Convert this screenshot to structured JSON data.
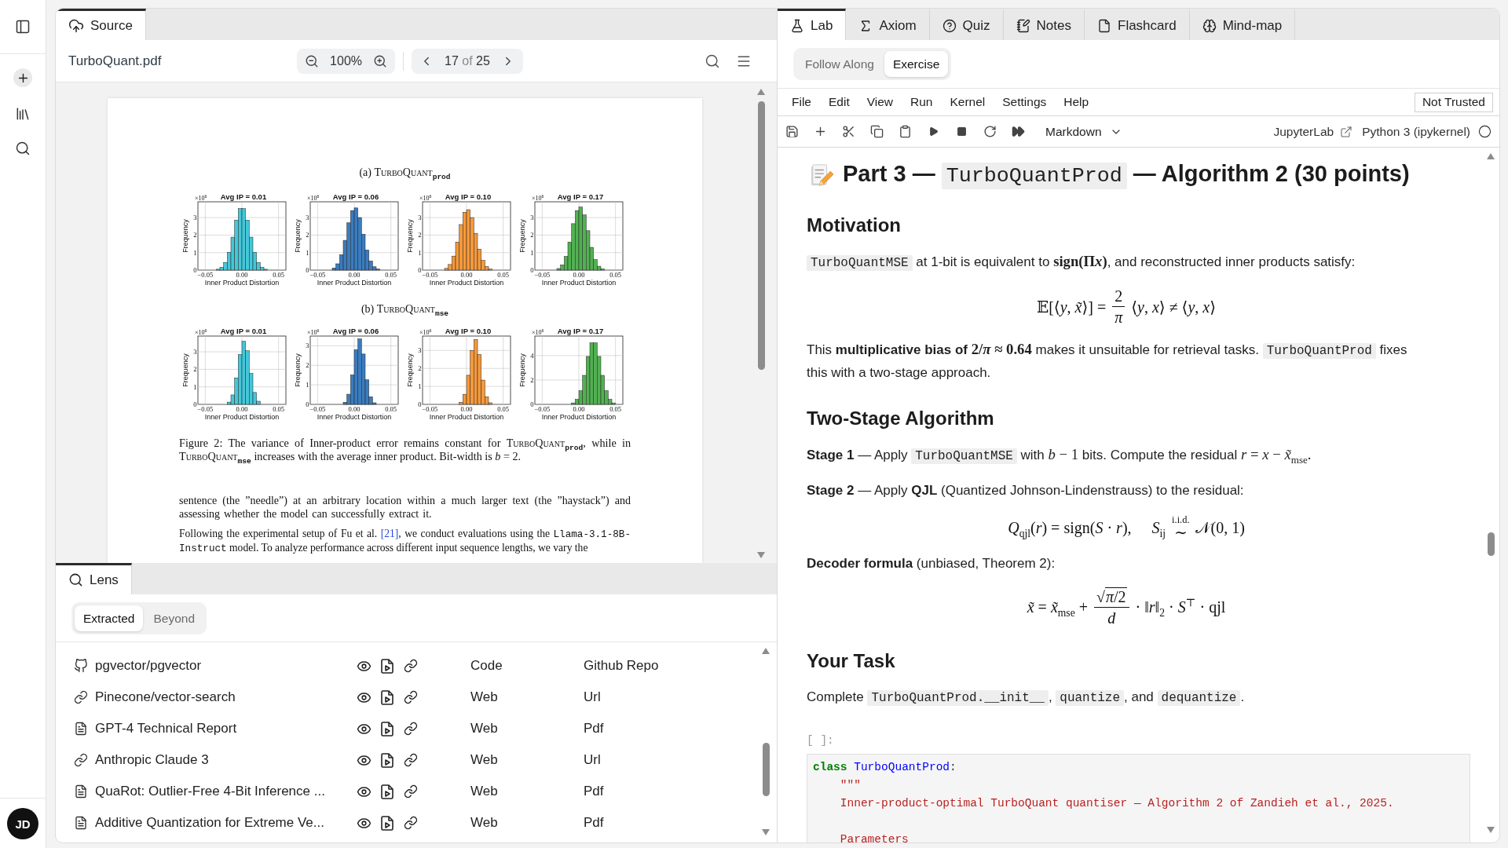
{
  "sidebar": {
    "avatar": "JD"
  },
  "source_panel": {
    "tab": {
      "label": "Source",
      "selected": true
    },
    "file_name": "TurboQuant.pdf",
    "zoom": "100%",
    "page": {
      "current": "17",
      "separator": "of",
      "total": "25"
    },
    "document": {
      "figures": [
        {
          "caption": [
            {
              "kind": "text",
              "text": "(a) "
            },
            {
              "kind": "smallcaps",
              "text": "TurboQuant"
            },
            {
              "kind": "text",
              "text": "$_{prod}$"
            }
          ],
          "charts": [
            {
              "scale_label": "×10$^{6}$",
              "chart_data": {
                "type": "bar",
                "title": "Avg IP = 0.01",
                "xlabel": "Inner Product Distortion",
                "ylabel": "Frequency",
                "x": [
                  -0.0325,
                  -0.0275,
                  -0.0225,
                  -0.0175,
                  -0.0125,
                  -0.0075,
                  -0.0025,
                  0.0025,
                  0.0075,
                  0.0125,
                  0.0175,
                  0.0225,
                  0.0275,
                  0.0325
                ],
                "series": [
                  {
                    "color": "#44c7d9",
                    "values": [
                      0.05,
                      0.16,
                      0.44,
                      1.02,
                      1.88,
                      2.85,
                      3.51,
                      3.51,
                      2.85,
                      1.88,
                      1.02,
                      0.44,
                      0.16,
                      0.05
                    ]
                  }
                ],
                "xlim": [
                  -0.06,
                  0.06
                ],
                "ylim": [
                  0,
                  3.9
                ],
                "xticks": [
                  {
                    "value": -0.05,
                    "label": "−0.05"
                  },
                  {
                    "value": 0,
                    "label": "0.00"
                  },
                  {
                    "value": 0.05,
                    "label": "0.05"
                  }
                ],
                "yticks": [
                  {
                    "value": 0,
                    "label": "0"
                  },
                  {
                    "value": 1,
                    "label": "1"
                  },
                  {
                    "value": 2,
                    "label": "2"
                  },
                  {
                    "value": 3,
                    "label": "3"
                  }
                ],
                "grid": true
              }
            },
            {
              "scale_label": "×10$^{6}$",
              "chart_data": {
                "type": "bar",
                "title": "Avg IP = 0.06",
                "xlabel": "Inner Product Distortion",
                "ylabel": "Frequency",
                "x": [
                  -0.0275,
                  -0.0225,
                  -0.0175,
                  -0.0125,
                  -0.0075,
                  -0.0025,
                  0.0025,
                  0.0075,
                  0.0125,
                  0.0175,
                  0.0225,
                  0.0275,
                  0.0325
                ],
                "series": [
                  {
                    "color": "#3b7cbf",
                    "values": [
                      0.12,
                      0.36,
                      0.88,
                      1.7,
                      2.7,
                      3.4,
                      3.55,
                      3.0,
                      2.05,
                      1.15,
                      0.52,
                      0.19,
                      0.06
                    ]
                  }
                ],
                "xlim": [
                  -0.06,
                  0.06
                ],
                "ylim": [
                  0,
                  3.9
                ],
                "xticks": [
                  {
                    "value": -0.05,
                    "label": "−0.05"
                  },
                  {
                    "value": 0,
                    "label": "0.00"
                  },
                  {
                    "value": 0.05,
                    "label": "0.05"
                  }
                ],
                "yticks": [
                  {
                    "value": 0,
                    "label": "0"
                  },
                  {
                    "value": 1,
                    "label": "1"
                  },
                  {
                    "value": 2,
                    "label": "2"
                  },
                  {
                    "value": 3,
                    "label": "3"
                  }
                ],
                "grid": true
              }
            },
            {
              "scale_label": "×10$^{6}$",
              "chart_data": {
                "type": "bar",
                "title": "Avg IP = 0.10",
                "xlabel": "Inner Product Distortion",
                "ylabel": "Frequency",
                "x": [
                  -0.0275,
                  -0.0225,
                  -0.0175,
                  -0.0125,
                  -0.0075,
                  -0.0025,
                  0.0025,
                  0.0075,
                  0.0125,
                  0.0175,
                  0.0225,
                  0.0275,
                  0.0325
                ],
                "series": [
                  {
                    "color": "#f5993b",
                    "values": [
                      0.1,
                      0.32,
                      0.8,
                      1.6,
                      2.6,
                      3.3,
                      3.45,
                      3.0,
                      2.1,
                      1.2,
                      0.55,
                      0.2,
                      0.06
                    ]
                  }
                ],
                "xlim": [
                  -0.06,
                  0.06
                ],
                "ylim": [
                  0,
                  3.9
                ],
                "xticks": [
                  {
                    "value": -0.05,
                    "label": "−0.05"
                  },
                  {
                    "value": 0,
                    "label": "0.00"
                  },
                  {
                    "value": 0.05,
                    "label": "0.05"
                  }
                ],
                "yticks": [
                  {
                    "value": 0,
                    "label": "0"
                  },
                  {
                    "value": 1,
                    "label": "1"
                  },
                  {
                    "value": 2,
                    "label": "2"
                  },
                  {
                    "value": 3,
                    "label": "3"
                  }
                ],
                "grid": true
              }
            },
            {
              "scale_label": "×10$^{6}$",
              "chart_data": {
                "type": "bar",
                "title": "Avg IP = 0.17",
                "xlabel": "Inner Product Distortion",
                "ylabel": "Frequency",
                "x": [
                  -0.0275,
                  -0.0225,
                  -0.0175,
                  -0.0125,
                  -0.0075,
                  -0.0025,
                  0.0025,
                  0.0075,
                  0.0125,
                  0.0175,
                  0.0225,
                  0.0275,
                  0.0325
                ],
                "series": [
                  {
                    "color": "#52b152",
                    "values": [
                      0.09,
                      0.3,
                      0.78,
                      1.6,
                      2.65,
                      3.4,
                      3.6,
                      3.15,
                      2.25,
                      1.3,
                      0.6,
                      0.22,
                      0.07
                    ]
                  }
                ],
                "xlim": [
                  -0.06,
                  0.06
                ],
                "ylim": [
                  0,
                  3.9
                ],
                "xticks": [
                  {
                    "value": -0.05,
                    "label": "−0.05"
                  },
                  {
                    "value": 0,
                    "label": "0.00"
                  },
                  {
                    "value": 0.05,
                    "label": "0.05"
                  }
                ],
                "yticks": [
                  {
                    "value": 0,
                    "label": "0"
                  },
                  {
                    "value": 1,
                    "label": "1"
                  },
                  {
                    "value": 2,
                    "label": "2"
                  },
                  {
                    "value": 3,
                    "label": "3"
                  }
                ],
                "grid": true
              }
            }
          ]
        },
        {
          "caption": [
            {
              "kind": "text",
              "text": "(b) "
            },
            {
              "kind": "smallcaps",
              "text": "TurboQuant"
            },
            {
              "kind": "text",
              "text": "$_{mse}$"
            }
          ],
          "charts": [
            {
              "scale_label": "×10$^{6}$",
              "chart_data": {
                "type": "bar",
                "title": "Avg IP = 0.01",
                "xlabel": "Inner Product Distortion",
                "ylabel": "Frequency",
                "x": [
                  -0.0175,
                  -0.0125,
                  -0.0075,
                  -0.0025,
                  0.0025,
                  0.0075,
                  0.0125,
                  0.0175,
                  0.0225
                ],
                "series": [
                  {
                    "color": "#44c7d9",
                    "values": [
                      0.13,
                      0.54,
                      1.51,
                      2.84,
                      3.6,
                      3.06,
                      1.76,
                      0.68,
                      0.18
                    ]
                  }
                ],
                "xlim": [
                  -0.06,
                  0.06
                ],
                "ylim": [
                  0,
                  3.9
                ],
                "xticks": [
                  {
                    "value": -0.05,
                    "label": "−0.05"
                  },
                  {
                    "value": 0,
                    "label": "0.00"
                  },
                  {
                    "value": 0.05,
                    "label": "0.05"
                  }
                ],
                "yticks": [
                  {
                    "value": 0,
                    "label": "0"
                  },
                  {
                    "value": 1,
                    "label": "1"
                  },
                  {
                    "value": 2,
                    "label": "2"
                  },
                  {
                    "value": 3,
                    "label": "3"
                  }
                ],
                "grid": true
              }
            },
            {
              "scale_label": "×10$^{6}$",
              "chart_data": {
                "type": "bar",
                "title": "Avg IP = 0.06",
                "xlabel": "Inner Product Distortion",
                "ylabel": "Frequency",
                "x": [
                  -0.0125,
                  -0.0075,
                  -0.0025,
                  0.0025,
                  0.0075,
                  0.0125,
                  0.0175,
                  0.0225,
                  0.0275
                ],
                "series": [
                  {
                    "color": "#3b7cbf",
                    "values": [
                      0.11,
                      0.52,
                      1.51,
                      2.8,
                      3.35,
                      2.58,
                      1.26,
                      0.39,
                      0.08
                    ]
                  }
                ],
                "xlim": [
                  -0.06,
                  0.06
                ],
                "ylim": [
                  0,
                  3.5
                ],
                "xticks": [
                  {
                    "value": -0.05,
                    "label": "−0.05"
                  },
                  {
                    "value": 0,
                    "label": "0.00"
                  },
                  {
                    "value": 0.05,
                    "label": "0.05"
                  }
                ],
                "yticks": [
                  {
                    "value": 0,
                    "label": "0"
                  },
                  {
                    "value": 1,
                    "label": "1"
                  },
                  {
                    "value": 2,
                    "label": "2"
                  },
                  {
                    "value": 3,
                    "label": "3"
                  }
                ],
                "grid": true
              }
            },
            {
              "scale_label": "×10$^{6}$",
              "chart_data": {
                "type": "bar",
                "title": "Avg IP = 0.10",
                "xlabel": "Inner Product Distortion",
                "ylabel": "Frequency",
                "x": [
                  -0.0075,
                  -0.0025,
                  0.0025,
                  0.0075,
                  0.0125,
                  0.0175,
                  0.0225,
                  0.0275,
                  0.0325
                ],
                "series": [
                  {
                    "color": "#f5993b",
                    "values": [
                      0.12,
                      0.56,
                      1.62,
                      3.0,
                      3.6,
                      2.77,
                      1.35,
                      0.42,
                      0.09
                    ]
                  }
                ],
                "xlim": [
                  -0.06,
                  0.06
                ],
                "ylim": [
                  0,
                  3.8
                ],
                "xticks": [
                  {
                    "value": -0.05,
                    "label": "−0.05"
                  },
                  {
                    "value": 0,
                    "label": "0.00"
                  },
                  {
                    "value": 0.05,
                    "label": "0.05"
                  }
                ],
                "yticks": [
                  {
                    "value": 0,
                    "label": "0"
                  },
                  {
                    "value": 1,
                    "label": "1"
                  },
                  {
                    "value": 2,
                    "label": "2"
                  },
                  {
                    "value": 3,
                    "label": "3"
                  }
                ],
                "grid": true
              }
            },
            {
              "scale_label": "×10$^{6}$",
              "chart_data": {
                "type": "bar",
                "title": "Avg IP = 0.17",
                "xlabel": "Inner Product Distortion",
                "ylabel": "Frequency",
                "x": [
                  -0.0075,
                  -0.0025,
                  0.0025,
                  0.0075,
                  0.0125,
                  0.0175,
                  0.0225,
                  0.0275,
                  0.0325,
                  0.0375,
                  0.0425,
                  0.0475
                ],
                "series": [
                  {
                    "color": "#52b152",
                    "values": [
                      0.12,
                      0.41,
                      1.12,
                      2.38,
                      3.93,
                      5.04,
                      5.04,
                      3.93,
                      2.38,
                      1.12,
                      0.41,
                      0.12
                    ]
                  }
                ],
                "xlim": [
                  -0.06,
                  0.06
                ],
                "ylim": [
                  0,
                  5.6
                ],
                "xticks": [
                  {
                    "value": -0.05,
                    "label": "−0.05"
                  },
                  {
                    "value": 0,
                    "label": "0.00"
                  },
                  {
                    "value": 0.05,
                    "label": "0.05"
                  }
                ],
                "yticks": [
                  {
                    "value": 0,
                    "label": "0"
                  },
                  {
                    "value": 2,
                    "label": "2"
                  },
                  {
                    "value": 4,
                    "label": "4"
                  }
                ],
                "grid": true
              }
            }
          ]
        }
      ],
      "figure_caption": [
        {
          "kind": "text",
          "text": "Figure 2: The variance of Inner-product error remains constant for "
        },
        {
          "kind": "smallcaps",
          "text": "TurboQuant"
        },
        {
          "kind": "text",
          "text": "$_{prod}$, while in "
        },
        {
          "kind": "smallcaps",
          "text": "TurboQuant"
        },
        {
          "kind": "text",
          "text": "$_{mse}$ increases with the average inner product. Bit-width is *b* = 2."
        }
      ],
      "paragraphs": [
        [
          {
            "kind": "text",
            "text": "sentence (the ”needle”) at an arbitrary location within a much larger text (the ”haystack”) and assessing whether the model can successfully extract it."
          }
        ],
        [
          {
            "kind": "text",
            "text": "Following the experimental setup of Fu et al. "
          },
          {
            "kind": "link",
            "text": "[21]"
          },
          {
            "kind": "text",
            "text": ", we conduct evaluations using the "
          },
          {
            "kind": "mono",
            "text": "Llama-3.1-8B-Instruct"
          },
          {
            "kind": "text",
            "text": " model. To analyze performance across different input sequence lengths, we vary the"
          }
        ]
      ]
    }
  },
  "lens_panel": {
    "tab": {
      "label": "Lens",
      "selected": true
    },
    "modes": [
      {
        "label": "Extracted",
        "selected": true
      },
      {
        "label": "Beyond",
        "selected": false
      }
    ],
    "items": [
      {
        "kind": "github",
        "title": "pgvector/pgvector",
        "column_2": "Code",
        "column_3": "Github Repo"
      },
      {
        "kind": "link",
        "title": "Pinecone/vector-search",
        "column_2": "Web",
        "column_3": "Url"
      },
      {
        "kind": "file",
        "title": "GPT-4 Technical Report",
        "column_2": "Web",
        "column_3": "Pdf"
      },
      {
        "kind": "link",
        "title": "Anthropic Claude 3",
        "column_2": "Web",
        "column_3": "Url"
      },
      {
        "kind": "file",
        "title": "QuaRot: Outlier-Free 4-Bit Inference ...",
        "column_2": "Web",
        "column_3": "Pdf"
      },
      {
        "kind": "file",
        "title": "Additive Quantization for Extreme Ve...",
        "column_2": "Web",
        "column_3": "Pdf"
      }
    ]
  },
  "lab_panel": {
    "tabs": [
      {
        "kind": "lab",
        "label": "Lab",
        "selected": true
      },
      {
        "kind": "axiom",
        "label": "Axiom",
        "selected": false
      },
      {
        "kind": "quiz",
        "label": "Quiz",
        "selected": false
      },
      {
        "kind": "notes",
        "label": "Notes",
        "selected": false
      },
      {
        "kind": "flashcard",
        "label": "Flashcard",
        "selected": false
      },
      {
        "kind": "mindmap",
        "label": "Mind-map",
        "selected": false
      }
    ],
    "modes": [
      {
        "label": "Follow Along",
        "selected": false
      },
      {
        "label": "Exercise",
        "selected": true
      }
    ],
    "menu": [
      "File",
      "Edit",
      "View",
      "Run",
      "Kernel",
      "Settings",
      "Help"
    ],
    "trust_status": "Not Trusted",
    "cell_type": "Markdown",
    "jupyter_link": "JupyterLab",
    "kernel": "Python 3 (ipykernel)",
    "notebook": [
      {
        "kind": "title",
        "segments": [
          {
            "kind": "text",
            "text": "Part 3 — "
          },
          {
            "kind": "code",
            "text": "TurboQuantProd"
          },
          {
            "kind": "text",
            "text": " — Algorithm 2 (30 points)"
          }
        ]
      },
      {
        "kind": "heading",
        "text": "Motivation"
      },
      {
        "kind": "paragraph",
        "segments": [
          {
            "kind": "code",
            "text": "TurboQuantMSE"
          },
          {
            "kind": "text",
            "text": " at 1-bit is equivalent to "
          },
          {
            "kind": "math_bold",
            "text": "sign(Π"
          },
          {
            "kind": "math_bold",
            "text": "*x*)"
          },
          {
            "kind": "text",
            "text": ", and reconstructed inner products satisfy:"
          }
        ]
      },
      {
        "kind": "fraction_formula",
        "lhs": "𝔼[⟨*y*, *x̃*⟩] =",
        "numerator": "2",
        "denominator": "*π*",
        "rhs": "⟨*y*, *x*⟩ ≠ ⟨*y*, *x*⟩"
      },
      {
        "kind": "paragraph",
        "segments": [
          {
            "kind": "text",
            "text": "This **multiplicative bias of** "
          },
          {
            "kind": "math_bold",
            "text": "2/*π* ≈ 0.64"
          },
          {
            "kind": "text",
            "text": " makes it unsuitable for retrieval tasks. "
          },
          {
            "kind": "code",
            "text": "TurboQuantProd"
          },
          {
            "kind": "text",
            "text": " fixes this with a two-stage approach."
          }
        ]
      },
      {
        "kind": "heading",
        "text": "Two-Stage Algorithm"
      },
      {
        "kind": "paragraph",
        "segments": [
          {
            "kind": "text",
            "text": "**Stage 1** — Apply "
          },
          {
            "kind": "code",
            "text": "TurboQuantMSE"
          },
          {
            "kind": "text",
            "text": " with "
          },
          {
            "kind": "math",
            "text": "*b* − 1"
          },
          {
            "kind": "text",
            "text": " bits. Compute the residual "
          },
          {
            "kind": "math",
            "text": "*r* = *x* − *x̃*$_{mse}$."
          }
        ]
      },
      {
        "kind": "paragraph",
        "segments": [
          {
            "kind": "text",
            "text": "**Stage 2** — Apply **QJL** (Quantized Johnson-Lindenstrauss) to the residual:"
          }
        ]
      },
      {
        "kind": "relation_formula",
        "lhs": "*Q*$_{qjl}$(*r*) = sign(*S* · *r*),",
        "subject": "*S*$_{ij}$",
        "relation": "∼",
        "relation_label": "i.i.d.",
        "rhs": "𝒩(0, 1)"
      },
      {
        "kind": "paragraph",
        "segments": [
          {
            "kind": "text",
            "text": "**Decoder formula** (unbiased, Theorem 2):"
          }
        ]
      },
      {
        "kind": "root_fraction_formula",
        "lhs": "*x̃* = *x̃*$_{mse}$ +",
        "radical": "√",
        "radicand": "*π*/2",
        "denominator": "*d*",
        "rhs": "· ‖*r*‖$_{2}$ · *S*$^{⊤}$ · qjl"
      },
      {
        "kind": "heading",
        "text": "Your Task"
      },
      {
        "kind": "paragraph",
        "segments": [
          {
            "kind": "text",
            "text": "Complete "
          },
          {
            "kind": "code",
            "text": "TurboQuantProd.__init__"
          },
          {
            "kind": "text",
            "text": ", "
          },
          {
            "kind": "code",
            "text": "quantize"
          },
          {
            "kind": "text",
            "text": ", and "
          },
          {
            "kind": "code",
            "text": "dequantize"
          },
          {
            "kind": "text",
            "text": "."
          }
        ]
      },
      {
        "kind": "code_cell",
        "prompt": "[ ]:",
        "lines": [
          {
            "kind": "code",
            "tokens": [
              {
                "kind": "keyword",
                "text": "class "
              },
              {
                "kind": "name",
                "text": "TurboQuantProd"
              },
              {
                "kind": "plain",
                "text": ":"
              }
            ]
          },
          {
            "kind": "code",
            "tokens": [
              {
                "kind": "string",
                "text": "    \"\"\""
              }
            ]
          },
          {
            "kind": "code",
            "tokens": [
              {
                "kind": "string",
                "text": "    Inner-product-optimal TurboQuant quantiser — Algorithm 2 of Zandieh et al., 2025."
              }
            ]
          },
          {
            "kind": "blank"
          },
          {
            "kind": "code",
            "tokens": [
              {
                "kind": "string",
                "text": "    Parameters"
              }
            ]
          }
        ]
      }
    ]
  }
}
